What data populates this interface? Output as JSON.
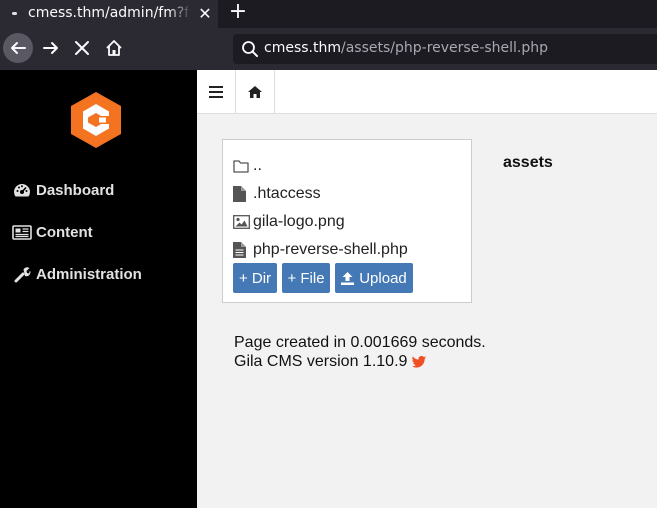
{
  "browser": {
    "tab_title": "cmess.thm/admin/fm?f=assets",
    "tab_close_icon": "close-icon",
    "new_tab_icon": "plus-icon",
    "nav": {
      "back_icon": "arrow-left-icon",
      "forward_icon": "arrow-right-icon",
      "stop_icon": "stop-x-icon",
      "home_icon": "home-icon"
    },
    "url": {
      "host": "cmess.thm",
      "path": "/assets/php-reverse-shell.php",
      "icon": "search-icon"
    }
  },
  "sidebar": {
    "logo_icon": "gila-logo-icon",
    "items": [
      {
        "label": "Dashboard",
        "icon": "dashboard-gauge-icon"
      },
      {
        "label": "Content",
        "icon": "newspaper-icon"
      },
      {
        "label": "Administration",
        "icon": "wrench-icon"
      }
    ]
  },
  "header": {
    "menu_icon": "hamburger-menu-icon",
    "home_icon": "home-icon"
  },
  "file_manager": {
    "folder_title": "assets",
    "entries": [
      {
        "name": "..",
        "icon": "folder-icon"
      },
      {
        "name": ".htaccess",
        "icon": "file-icon"
      },
      {
        "name": "gila-logo.png",
        "icon": "image-file-icon"
      },
      {
        "name": "php-reverse-shell.php",
        "icon": "text-file-icon"
      }
    ],
    "buttons": {
      "dir": "+ Dir",
      "file": "+ File",
      "upload": "Upload",
      "upload_icon": "upload-icon"
    }
  },
  "footer": {
    "line1": "Page created in 0.001669 seconds.",
    "line2": "Gila CMS version 1.10.9",
    "twitter_icon": "twitter-bird-icon"
  },
  "colors": {
    "sidebar_bg": "#000000",
    "logo_orange": "#f47321",
    "button_blue": "#4479b5",
    "twitter_orange": "#f04e23"
  }
}
